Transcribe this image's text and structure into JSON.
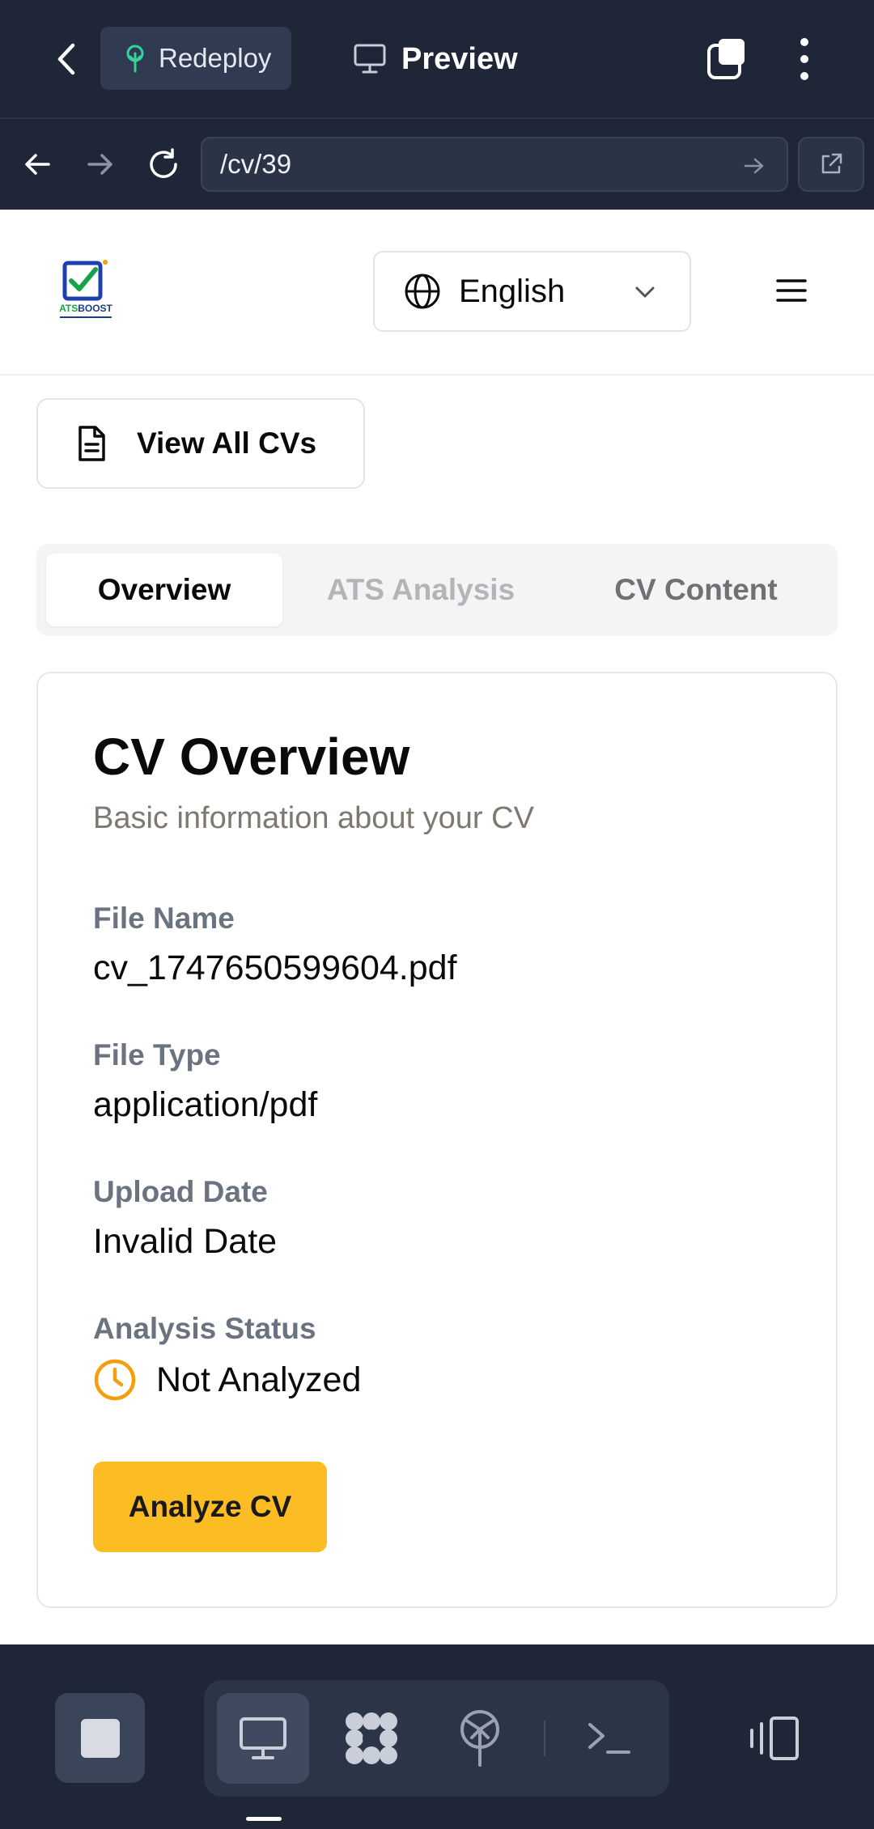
{
  "browser": {
    "redeploy_label": "Redeploy",
    "preview_label": "Preview",
    "url": "/cv/39"
  },
  "header": {
    "language": "English",
    "logo_text": "ATSBOOST"
  },
  "actions": {
    "view_all_cvs": "View All CVs"
  },
  "tabs": [
    {
      "label": "Overview",
      "active": true
    },
    {
      "label": "ATS Analysis",
      "active": false
    },
    {
      "label": "CV Content",
      "active": false
    }
  ],
  "card": {
    "title": "CV Overview",
    "subtitle": "Basic information about your CV",
    "fields": [
      {
        "label": "File Name",
        "value": "cv_1747650599604.pdf"
      },
      {
        "label": "File Type",
        "value": "application/pdf"
      },
      {
        "label": "Upload Date",
        "value": "Invalid Date"
      }
    ],
    "status_label": "Analysis Status",
    "status_value": "Not Analyzed",
    "analyze_button": "Analyze CV"
  },
  "colors": {
    "app_bar": "#1f2638",
    "accent_button": "#fbbd23",
    "status_clock": "#f59e0b",
    "redeploy_icon": "#34d399"
  }
}
